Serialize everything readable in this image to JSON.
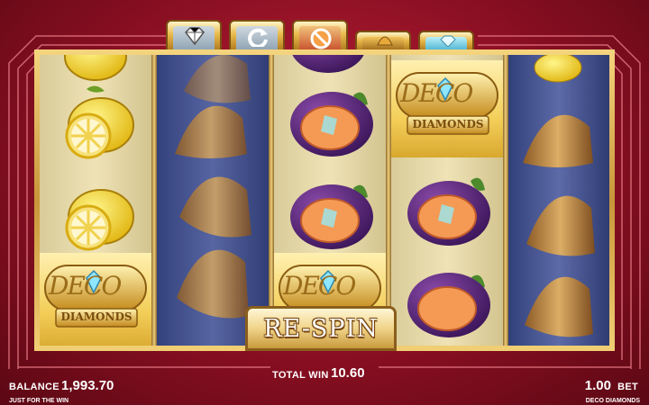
{
  "colors": {
    "background": "#a3152c",
    "gold": "#e8b94a",
    "reel_bg": "#efe3b6",
    "spin_reel": "#4a5896"
  },
  "top_tabs": [
    "diamond-icon",
    "replay-arrow-icon",
    "no-symbol-icon",
    "bell-icon",
    "diamond-icon"
  ],
  "reels": [
    {
      "state": "stopped",
      "symbols": [
        "lemon",
        "lemon",
        "lemon",
        "deco-diamonds"
      ]
    },
    {
      "state": "spinning",
      "symbols": [
        "bell",
        "bell",
        "bell"
      ]
    },
    {
      "state": "stopped",
      "symbols": [
        "plum",
        "plum",
        "plum",
        "deco-diamonds"
      ]
    },
    {
      "state": "stopped",
      "symbols": [
        "deco-diamonds",
        "plum",
        "plum"
      ]
    },
    {
      "state": "spinning",
      "symbols": [
        "bell",
        "bell",
        "bell"
      ]
    }
  ],
  "logo_text": {
    "line1": "DECO",
    "line2": "DIAMONDS"
  },
  "respin_button": {
    "label": "RE-SPIN"
  },
  "balance": {
    "label": "BALANCE",
    "value": "1,993.70"
  },
  "total_win": {
    "label": "TOTAL WIN",
    "value": "10.60"
  },
  "bet": {
    "label": "BET",
    "value": "1.00"
  },
  "provider": "JUST FOR THE WIN",
  "game_name": "DECO DIAMONDS"
}
